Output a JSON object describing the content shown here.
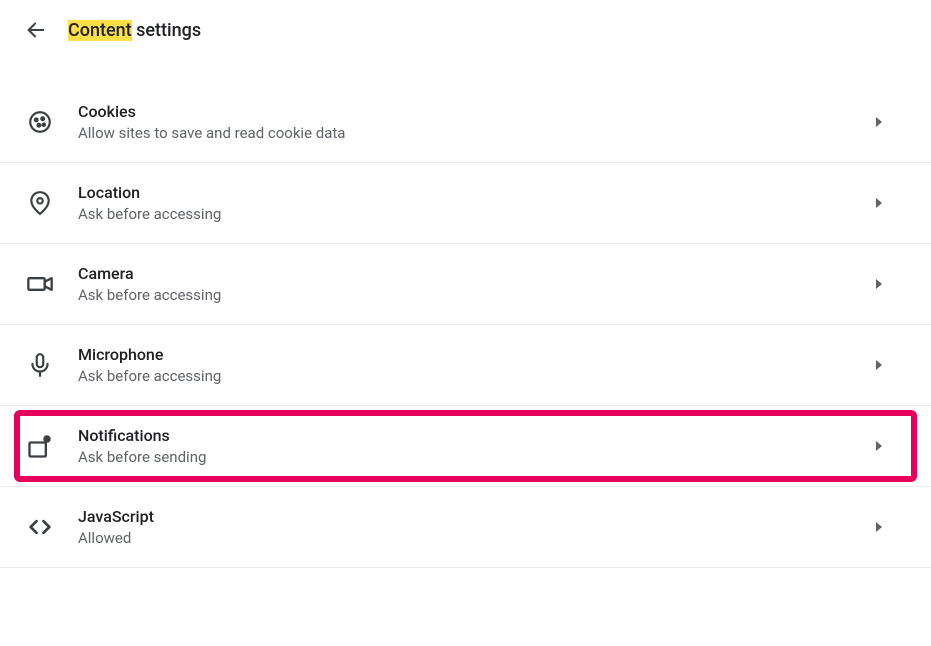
{
  "header": {
    "title_highlighted": "Content",
    "title_rest": " settings"
  },
  "settings": [
    {
      "title": "Cookies",
      "subtitle": "Allow sites to save and read cookie data"
    },
    {
      "title": "Location",
      "subtitle": "Ask before accessing"
    },
    {
      "title": "Camera",
      "subtitle": "Ask before accessing"
    },
    {
      "title": "Microphone",
      "subtitle": "Ask before accessing"
    },
    {
      "title": "Notifications",
      "subtitle": "Ask before sending"
    },
    {
      "title": "JavaScript",
      "subtitle": "Allowed"
    }
  ]
}
